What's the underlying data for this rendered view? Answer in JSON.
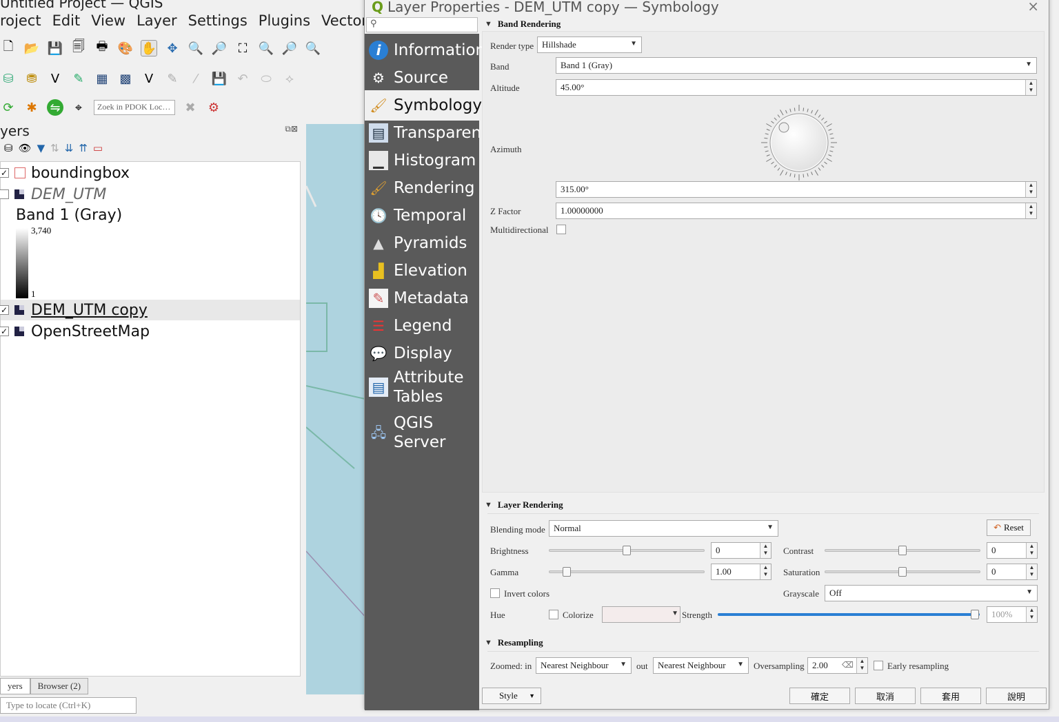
{
  "qgis": {
    "window_title": "Untitled Project — QGIS",
    "menu": [
      "roject",
      "Edit",
      "View",
      "Layer",
      "Settings",
      "Plugins",
      "Vector"
    ],
    "pdok_placeholder": "Zoek in PDOK Loc…",
    "layers_panel_title": "yers",
    "layers": [
      {
        "name": "boundingbox",
        "checked": true
      },
      {
        "name": "DEM_UTM",
        "checked": false
      },
      {
        "name": "DEM_UTM copy",
        "checked": true
      },
      {
        "name": "OpenStreetMap",
        "checked": true
      }
    ],
    "legend": {
      "band_label": "Band 1 (Gray)",
      "max": "3,740",
      "min": "1"
    },
    "bottom_tabs": [
      "yers",
      "Browser (2)"
    ],
    "locator_placeholder": "Type to locate (Ctrl+K)"
  },
  "dialog": {
    "title": "Layer Properties - DEM_UTM copy — Symbology",
    "close": "×",
    "nav": [
      {
        "label": "Information",
        "icon": "info-icon"
      },
      {
        "label": "Source",
        "icon": "source-icon"
      },
      {
        "label": "Symbology",
        "icon": "symbology-icon",
        "active": true
      },
      {
        "label": "Transparency",
        "icon": "transparency-icon"
      },
      {
        "label": "Histogram",
        "icon": "histogram-icon"
      },
      {
        "label": "Rendering",
        "icon": "rendering-icon"
      },
      {
        "label": "Temporal",
        "icon": "temporal-icon"
      },
      {
        "label": "Pyramids",
        "icon": "pyramids-icon"
      },
      {
        "label": "Elevation",
        "icon": "elevation-icon"
      },
      {
        "label": "Metadata",
        "icon": "metadata-icon"
      },
      {
        "label": "Legend",
        "icon": "legend-icon"
      },
      {
        "label": "Display",
        "icon": "display-icon"
      },
      {
        "label": "Attribute Tables",
        "icon": "attribute-tables-icon"
      },
      {
        "label": "QGIS Server",
        "icon": "qgis-server-icon"
      }
    ],
    "band_rendering": {
      "header": "Band Rendering",
      "render_type_label": "Render type",
      "render_type": "Hillshade",
      "band_label": "Band",
      "band": "Band 1 (Gray)",
      "altitude_label": "Altitude",
      "altitude": "45.00°",
      "azimuth_label": "Azimuth",
      "azimuth": "315.00°",
      "z_factor_label": "Z Factor",
      "z_factor": "1.00000000",
      "multidirectional_label": "Multidirectional",
      "multidirectional": false
    },
    "layer_rendering": {
      "header": "Layer Rendering",
      "blending_label": "Blending mode",
      "blending": "Normal",
      "reset": "Reset",
      "brightness_label": "Brightness",
      "brightness": "0",
      "contrast_label": "Contrast",
      "contrast": "0",
      "gamma_label": "Gamma",
      "gamma": "1.00",
      "saturation_label": "Saturation",
      "saturation": "0",
      "invert_label": "Invert colors",
      "grayscale_label": "Grayscale",
      "grayscale": "Off",
      "hue_label": "Hue",
      "colorize_label": "Colorize",
      "strength_label": "Strength",
      "strength": "100%"
    },
    "resampling": {
      "header": "Resampling",
      "zoomed_in_label": "Zoomed: in",
      "zoomed_in": "Nearest Neighbour",
      "out_label": "out",
      "zoomed_out": "Nearest Neighbour",
      "oversampling_label": "Oversampling",
      "oversampling": "2.00",
      "early_label": "Early resampling"
    },
    "footer": {
      "style": "Style",
      "ok": "確定",
      "cancel": "取消",
      "apply": "套用",
      "help": "說明"
    }
  },
  "colors": {
    "nav_bg": "#5a5a5a",
    "map_water": "#aed3df",
    "accent": "#2a7fd4"
  }
}
